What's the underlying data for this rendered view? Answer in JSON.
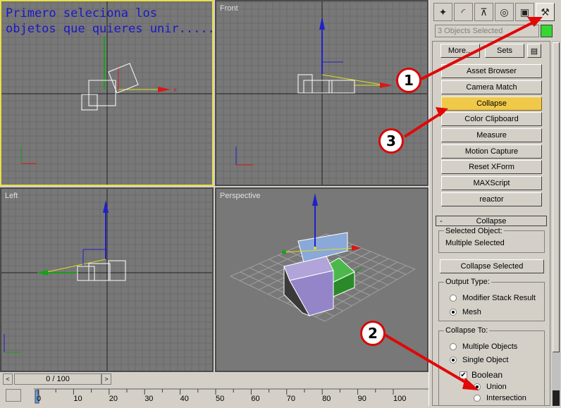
{
  "annotation": {
    "line1": "Primero seleciona los",
    "line2": "objetos que quieres unir....."
  },
  "viewports": {
    "front": "Front",
    "left": "Left",
    "perspective": "Perspective"
  },
  "panel": {
    "tab_icons": [
      "create-icon",
      "modify-icon",
      "hierarchy-icon",
      "motion-icon",
      "display-icon",
      "utilities-icon"
    ],
    "selection": "3 Objects Selected",
    "color": "#35d832",
    "more_label": "More...",
    "sets_label": "Sets",
    "utilities": [
      "Asset Browser",
      "Camera Match",
      "Collapse",
      "Color Clipboard",
      "Measure",
      "Motion Capture",
      "Reset XForm",
      "MAXScript",
      "reactor"
    ],
    "rollout_minus": "-",
    "rollout_title": "Collapse",
    "selected_object_label": "Selected Object:",
    "selected_object_value": "Multiple Selected",
    "collapse_selected": "Collapse Selected",
    "output_type_label": "Output Type:",
    "output_options": [
      "Modifier Stack Result",
      "Mesh"
    ],
    "collapse_to_label": "Collapse To:",
    "collapse_options": [
      "Multiple Objects",
      "Single Object"
    ],
    "boolean_label": "Boolean",
    "union_label": "Union",
    "intersection_label": "Intersection"
  },
  "timeline": {
    "frame": "0 / 100",
    "ticks": [
      "0",
      "10",
      "20",
      "30",
      "40",
      "50",
      "60",
      "70",
      "80",
      "90",
      "100"
    ]
  },
  "callouts": [
    "1",
    "2",
    "3"
  ]
}
